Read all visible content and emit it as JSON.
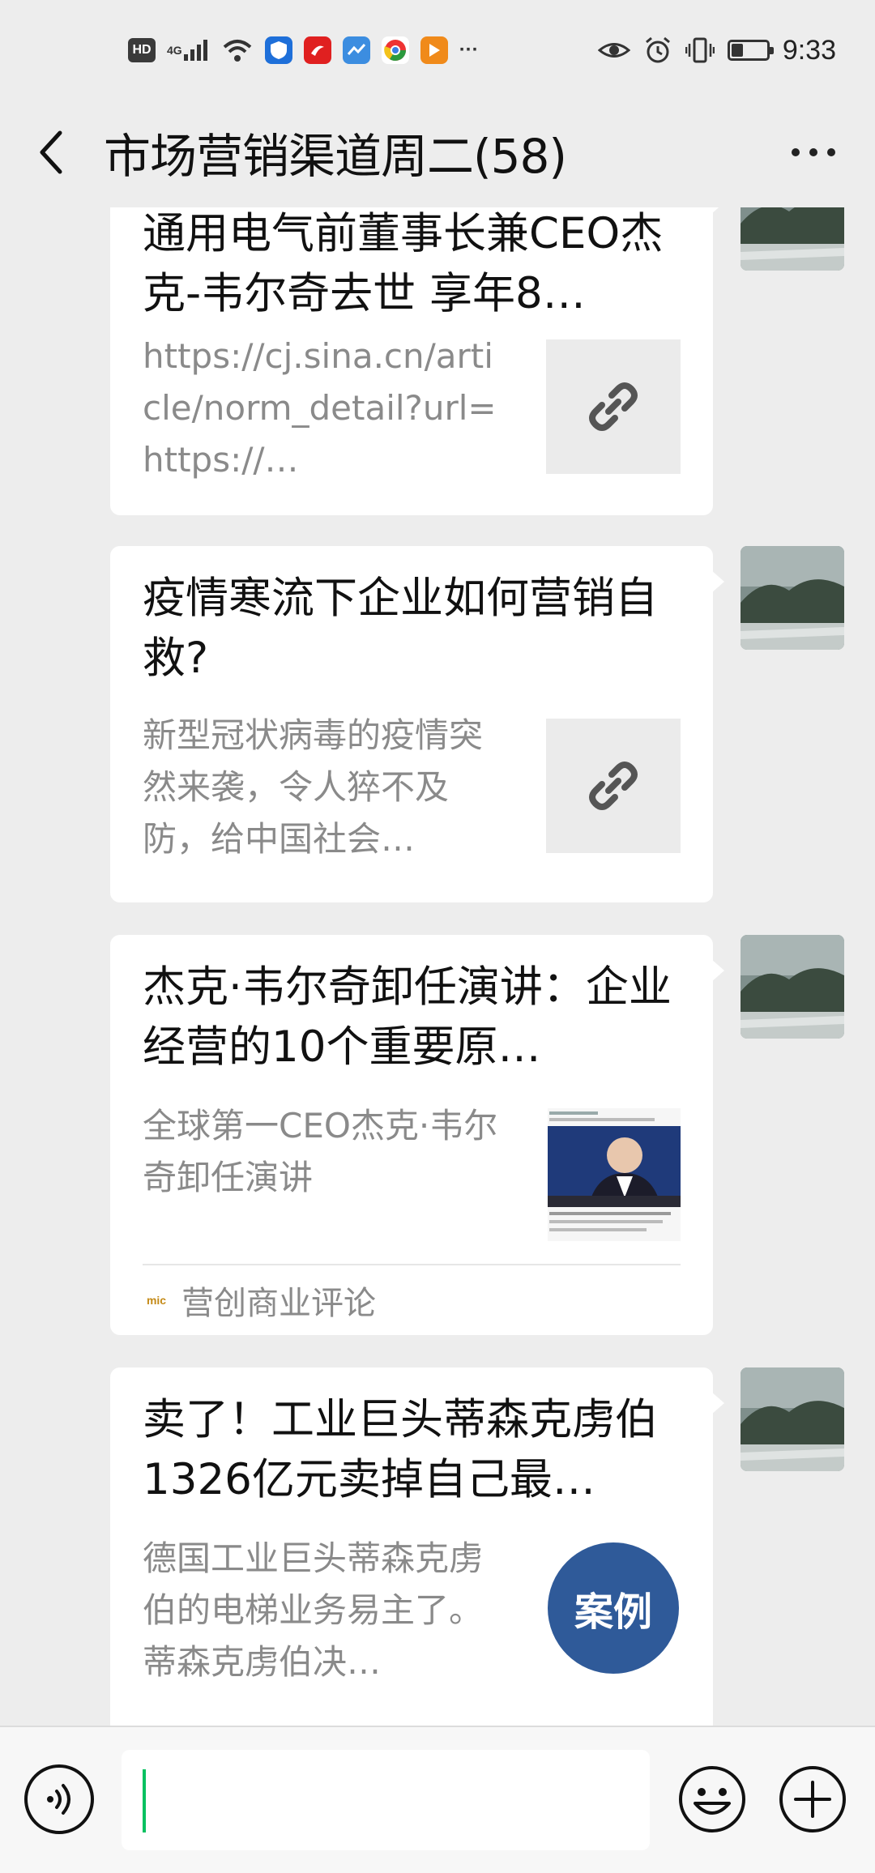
{
  "status_bar": {
    "network_label": "HD",
    "signal_label": "4G",
    "overflow": "···",
    "time": "9:33",
    "battery_level": 0.35,
    "icons": [
      "hd-icon",
      "signal-icon",
      "wifi-icon",
      "shield-app-icon",
      "red-app-icon",
      "blue-app-icon",
      "chrome-app-icon",
      "orange-app-icon",
      "eye-icon",
      "alarm-icon",
      "vibrate-icon",
      "battery-icon"
    ]
  },
  "nav": {
    "title": "市场营销渠道周二(58)",
    "back_icon": "chevron-left-icon",
    "more_icon": "more-dots-icon"
  },
  "messages": [
    {
      "title": "通用电气前董事长兼CEO杰克-韦尔奇去世 享年8…",
      "desc": "https://cj.sina.cn/article/norm_detail?url=https://…",
      "thumb": "link-icon"
    },
    {
      "title": "疫情寒流下企业如何营销自救?",
      "desc": "新型冠状病毒的疫情突然来袭，令人猝不及防，给中国社会…",
      "thumb": "link-icon"
    },
    {
      "title": "杰克·韦尔奇卸任演讲：企业经营的10个重要原…",
      "desc": "全球第一CEO杰克·韦尔奇卸任演讲",
      "thumb": "photo-thumbnail",
      "source_logo": "mic",
      "source_name": "营创商业评论"
    },
    {
      "title": "卖了！工业巨头蒂森克虏伯1326亿元卖掉自己最…",
      "desc": "德国工业巨头蒂森克虏伯的电梯业务易主了。蒂森克虏伯决…",
      "badge": "案例"
    }
  ],
  "input_bar": {
    "voice_icon": "voice-icon",
    "text_value": "",
    "emoji_icon": "emoji-icon",
    "plus_icon": "plus-icon"
  },
  "colors": {
    "background": "#ededed",
    "card": "#ffffff",
    "badge": "#2f5a99",
    "cursor": "#07c160"
  }
}
